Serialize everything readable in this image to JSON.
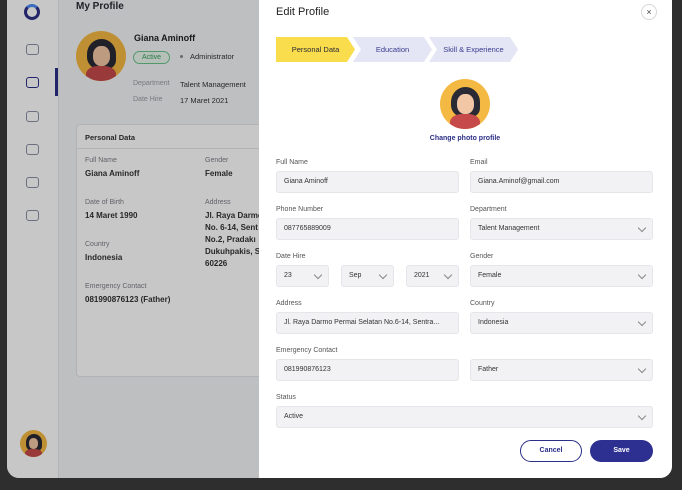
{
  "background": {
    "page_title": "My Profile",
    "profile": {
      "name": "Giana Aminoff",
      "status": "Active",
      "role": "Administrator",
      "department_label": "Department",
      "department": "Talent Management",
      "date_hire_label": "Date Hire",
      "date_hire": "17 Maret 2021"
    },
    "personal_data": {
      "title": "Personal Data",
      "full_name_label": "Full Name",
      "full_name": "Giana Aminoff",
      "gender_label": "Gender",
      "gender": "Female",
      "dob_label": "Date of Birth",
      "dob": "14 Maret 1990",
      "address_label": "Address",
      "address_lines": [
        "Jl. Raya Darmo",
        "No. 6-14, Sent",
        "No.2, Pradakı",
        "Dukuhpakis, S",
        "60226"
      ],
      "country_label": "Country",
      "country": "Indonesia",
      "emergency_label": "Emergency Contact",
      "emergency": "081990876123 (Father)"
    }
  },
  "modal": {
    "title": "Edit Profile",
    "close_label": "×",
    "steps": [
      "Personal Data",
      "Education",
      "Skill & Experience"
    ],
    "change_photo": "Change photo profile",
    "fields": {
      "full_name": {
        "label": "Full Name",
        "value": "Giana Aminoff"
      },
      "email": {
        "label": "Email",
        "value": "Giana.Aminof@gmail.com"
      },
      "phone": {
        "label": "Phone Number",
        "value": "087765889009"
      },
      "department": {
        "label": "Department",
        "value": "Talent Management"
      },
      "date_hire": {
        "label": "Date Hire",
        "day": "23",
        "month": "Sep",
        "year": "2021"
      },
      "gender": {
        "label": "Gender",
        "value": "Female"
      },
      "address": {
        "label": "Address",
        "value": "Jl. Raya Darmo Permai Selatan No.6-14, Sentra..."
      },
      "country": {
        "label": "Country",
        "value": "Indonesia"
      },
      "emergency": {
        "label": "Emergency Contact",
        "value": "081990876123"
      },
      "relation": {
        "value": "Father"
      },
      "status": {
        "label": "Status",
        "value": "Active"
      }
    },
    "cancel_label": "Cancel",
    "save_label": "Save"
  },
  "colors": {
    "primary": "#2d3091",
    "active_step": "#f9dd4c",
    "inactive_step": "#e4e5f5",
    "active_badge": "#2e9e57"
  },
  "icons": [
    "app-logo-icon",
    "users-icon",
    "briefcase-icon",
    "user-icon",
    "id-card-icon",
    "settings-icon",
    "logout-icon",
    "close-icon",
    "chevron-down-icon"
  ]
}
